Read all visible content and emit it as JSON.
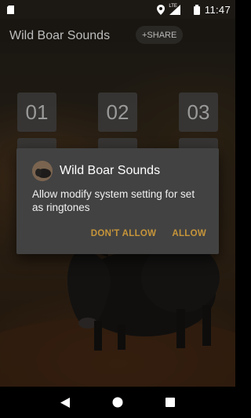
{
  "status_bar": {
    "time": "11:47",
    "icons": [
      "sd-card-icon",
      "location-icon",
      "lte-signal-icon",
      "battery-icon"
    ],
    "lte_label": "LTE"
  },
  "toolbar": {
    "title": "Wild Boar Sounds",
    "share_label": "+SHARE"
  },
  "grid": {
    "tiles": [
      "01",
      "02",
      "03"
    ]
  },
  "dialog": {
    "app_icon": "wild-boar-app-icon",
    "title": "Wild Boar Sounds",
    "message": "Allow modify system setting for set as ringtones",
    "deny_label": "DON'T ALLOW",
    "allow_label": "ALLOW"
  },
  "nav_bar": {
    "icons": [
      "back-icon",
      "home-icon",
      "recents-icon"
    ]
  },
  "colors": {
    "dialog_bg": "#424242",
    "accent": "#c6953a",
    "tile_bg": "#3a3a3a"
  }
}
